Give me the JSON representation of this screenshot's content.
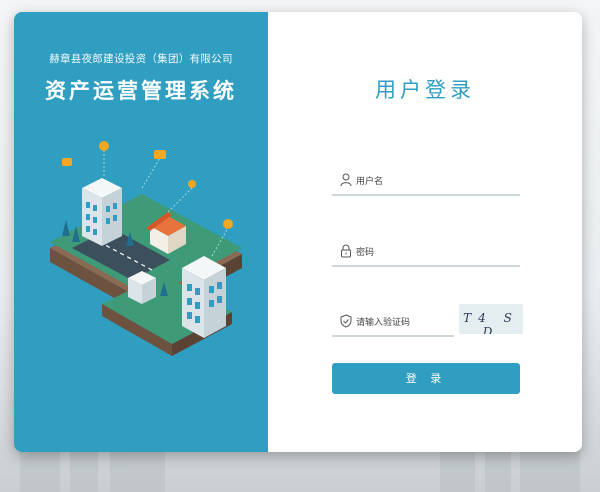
{
  "branding": {
    "company_name": "赫章县夜郎建设投资（集团）有限公司",
    "system_title": "资产运营管理系统"
  },
  "login_form": {
    "title": "用户登录",
    "username_placeholder": "用户名",
    "password_placeholder": "密码",
    "captcha_placeholder": "请输入验证码",
    "captcha_code": "T4 S D",
    "submit_label": "登 录"
  },
  "colors": {
    "brand": "#2f9ec1",
    "field_line": "#cfd6da",
    "illustration_ground": "#3f9a78",
    "building_accent": "#f5a623"
  },
  "icons": [
    "user-icon",
    "lock-icon",
    "shield-icon"
  ]
}
